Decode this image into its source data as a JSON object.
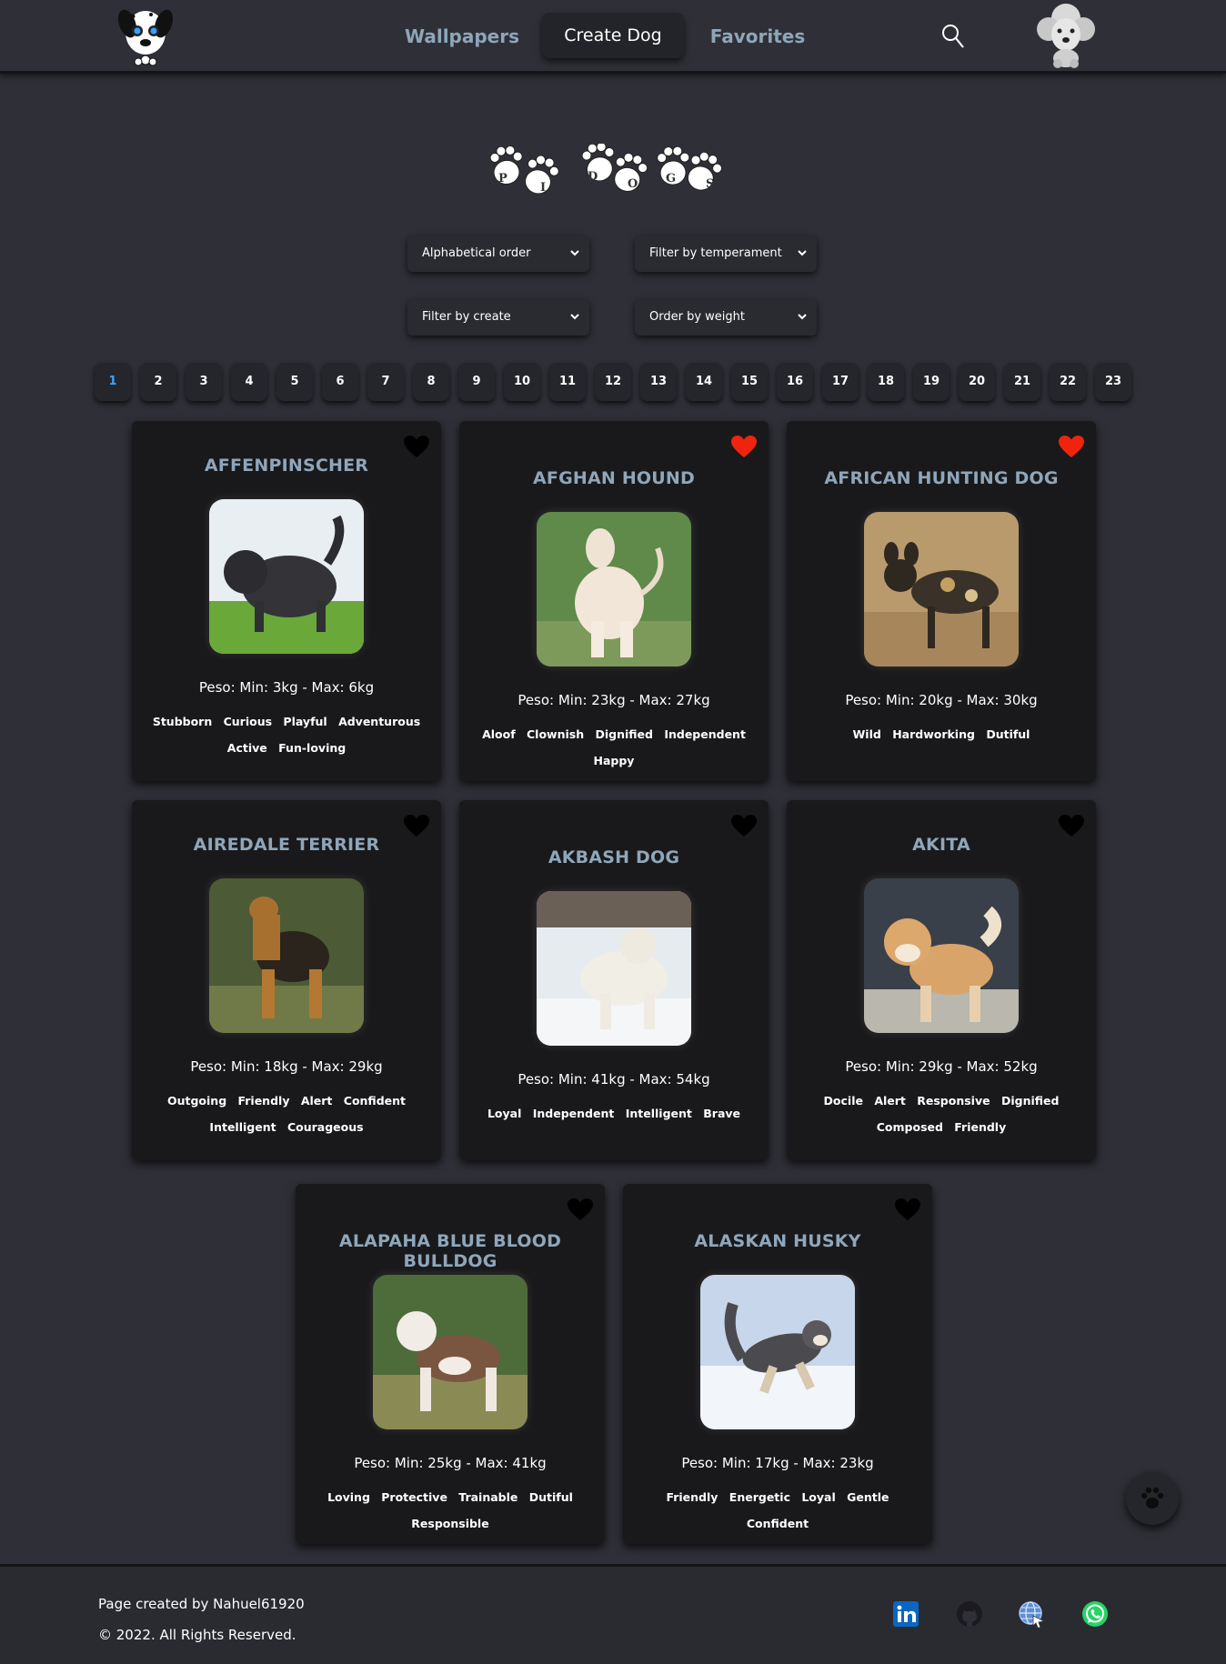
{
  "nav": {
    "wallpapers": "Wallpapers",
    "create_dog": "Create Dog",
    "favorites": "Favorites"
  },
  "filters": {
    "alphabetical": "Alphabetical order",
    "temperament": "Filter by temperament",
    "create": "Filter by create",
    "weight": "Order by weight"
  },
  "pagination": {
    "current": "1",
    "pages": [
      "1",
      "2",
      "3",
      "4",
      "5",
      "6",
      "7",
      "8",
      "9",
      "10",
      "11",
      "12",
      "13",
      "14",
      "15",
      "16",
      "17",
      "18",
      "19",
      "20",
      "21",
      "22",
      "23"
    ]
  },
  "colors": {
    "accent_active_page": "#38a4ff",
    "favorite_heart": "#f0230f",
    "card_title": "#8fa6ba"
  },
  "cards": [
    {
      "name": "AFFENPINSCHER",
      "weight": "Peso: Min: 3kg - Max: 6kg",
      "favorite": false,
      "temperaments": [
        "Stubborn",
        "Curious",
        "Playful",
        "Adventurous",
        "Active",
        "Fun-loving"
      ]
    },
    {
      "name": "AFGHAN HOUND",
      "weight": "Peso: Min: 23kg - Max: 27kg",
      "favorite": true,
      "temperaments": [
        "Aloof",
        "Clownish",
        "Dignified",
        "Independent",
        "Happy"
      ]
    },
    {
      "name": "AFRICAN HUNTING DOG",
      "weight": "Peso: Min: 20kg - Max: 30kg",
      "favorite": true,
      "temperaments": [
        "Wild",
        "Hardworking",
        "Dutiful"
      ]
    },
    {
      "name": "AIREDALE TERRIER",
      "weight": "Peso: Min: 18kg - Max: 29kg",
      "favorite": false,
      "temperaments": [
        "Outgoing",
        "Friendly",
        "Alert",
        "Confident",
        "Intelligent",
        "Courageous"
      ]
    },
    {
      "name": "AKBASH DOG",
      "weight": "Peso: Min: 41kg - Max: 54kg",
      "favorite": false,
      "temperaments": [
        "Loyal",
        "Independent",
        "Intelligent",
        "Brave"
      ]
    },
    {
      "name": "AKITA",
      "weight": "Peso: Min: 29kg - Max: 52kg",
      "favorite": false,
      "temperaments": [
        "Docile",
        "Alert",
        "Responsive",
        "Dignified",
        "Composed",
        "Friendly"
      ]
    },
    {
      "name": "ALAPAHA BLUE BLOOD BULLDOG",
      "weight": "Peso: Min: 25kg - Max: 41kg",
      "favorite": false,
      "temperaments": [
        "Loving",
        "Protective",
        "Trainable",
        "Dutiful",
        "Responsible"
      ]
    },
    {
      "name": "ALASKAN HUSKY",
      "weight": "Peso: Min: 17kg - Max: 23kg",
      "favorite": false,
      "temperaments": [
        "Friendly",
        "Energetic",
        "Loyal",
        "Gentle",
        "Confident"
      ]
    }
  ],
  "footer": {
    "created_by": "Page created by Nahuel61920",
    "copyright": "© 2022. All Rights Reserved.",
    "social": [
      "linkedin-icon",
      "github-icon",
      "web-icon",
      "whatsapp-icon"
    ]
  }
}
